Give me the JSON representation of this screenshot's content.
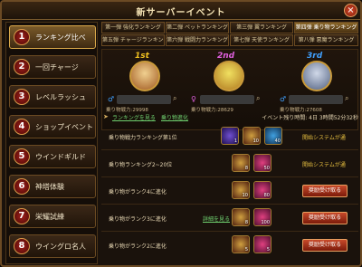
{
  "window": {
    "title": "新サーバーイベント",
    "close": "×"
  },
  "sidebar": {
    "items": [
      {
        "num": "1",
        "label": "ランキング比べ"
      },
      {
        "num": "2",
        "label": "一回チャージ"
      },
      {
        "num": "3",
        "label": "レベルラッシュ"
      },
      {
        "num": "4",
        "label": "ショップイベント"
      },
      {
        "num": "5",
        "label": "ウインドギルド"
      },
      {
        "num": "6",
        "label": "神塔体験"
      },
      {
        "num": "7",
        "label": "栄耀試練"
      },
      {
        "num": "8",
        "label": "ウイングロ名人"
      }
    ]
  },
  "tabs": [
    "第一弾 強化ランキング",
    "第二弾 ペットランキング",
    "第三弾 翼ランキング",
    "第四弾 乗り物ランキング",
    "第五弾 チャージランキング",
    "第六弾 戦闘力ランキング",
    "第七弾 天使ランキング",
    "第八弾 悪魔ランキング"
  ],
  "podium": [
    {
      "rank": "1st",
      "gender": "♂",
      "stat": "乗り物戦力:29998",
      "color": "#f0c020"
    },
    {
      "rank": "2nd",
      "gender": "♀",
      "stat": "乗り物戦力:28629",
      "color": "#e060e0"
    },
    {
      "rank": "3rd",
      "gender": "♂",
      "stat": "乗り物戦力:27608",
      "color": "#40a0ff"
    }
  ],
  "info": {
    "link1": "ランキングを見る",
    "link2": "乗り物進化",
    "period": "イベント残り時間: 4日 3時間52分32秒"
  },
  "rows": [
    {
      "desc": "乗り物戦力ランキング第1位",
      "status": "開始システムが通",
      "items": [
        {
          "q": "1"
        },
        {
          "q": "10"
        },
        {
          "q": "40"
        }
      ]
    },
    {
      "desc": "乗り物ランキング2~20位",
      "status": "開始システムが通",
      "items": [
        {
          "q": "8"
        },
        {
          "q": "50"
        }
      ]
    },
    {
      "desc": "乗り物がランク4に進化",
      "claim": "奨励受け取る",
      "items": [
        {
          "q": "10"
        },
        {
          "q": "80"
        }
      ]
    },
    {
      "desc": "乗り物がランク3に進化",
      "link": "詳細を見る",
      "claim": "奨励受け取る",
      "items": [
        {
          "q": "8"
        },
        {
          "q": "100"
        }
      ]
    },
    {
      "desc": "乗り物がランク2に進化",
      "claim": "奨励受け取る",
      "items": [
        {
          "q": "5"
        },
        {
          "q": "5"
        }
      ]
    }
  ]
}
